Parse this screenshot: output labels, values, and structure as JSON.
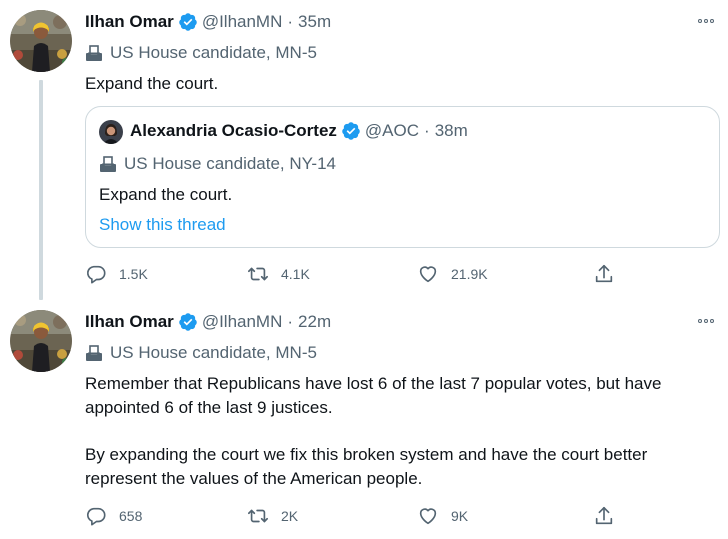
{
  "tweets": [
    {
      "name": "Ilhan Omar",
      "handle": "@IlhanMN",
      "separator": "·",
      "time": "35m",
      "label": "US House candidate, MN-5",
      "paragraphs": [
        "Expand the court."
      ],
      "quote": {
        "name": "Alexandria Ocasio-Cortez",
        "handle": "@AOC",
        "separator": "·",
        "time": "38m",
        "label": "US House candidate, NY-14",
        "text": "Expand the court.",
        "link": "Show this thread"
      },
      "replies": "1.5K",
      "retweets": "4.1K",
      "likes": "21.9K"
    },
    {
      "name": "Ilhan Omar",
      "handle": "@IlhanMN",
      "separator": "·",
      "time": "22m",
      "label": "US House candidate, MN-5",
      "paragraphs": [
        "Remember that Republicans have lost 6 of the last 7 popular votes, but have appointed 6 of the last 9 justices.",
        "By expanding the court we fix this broken system and have the court better represent the values of the American people."
      ],
      "replies": "658",
      "retweets": "2K",
      "likes": "9K"
    }
  ],
  "icons": {
    "verified": "verified-badge-icon",
    "ballot": "ballot-box-icon",
    "more": "more-dots-icon",
    "reply": "reply-icon",
    "retweet": "retweet-icon",
    "like": "heart-icon",
    "share": "share-icon"
  },
  "colors": {
    "text": "#0f1419",
    "secondary": "#536471",
    "accent": "#1d9bf0",
    "border": "#cfd9de"
  }
}
